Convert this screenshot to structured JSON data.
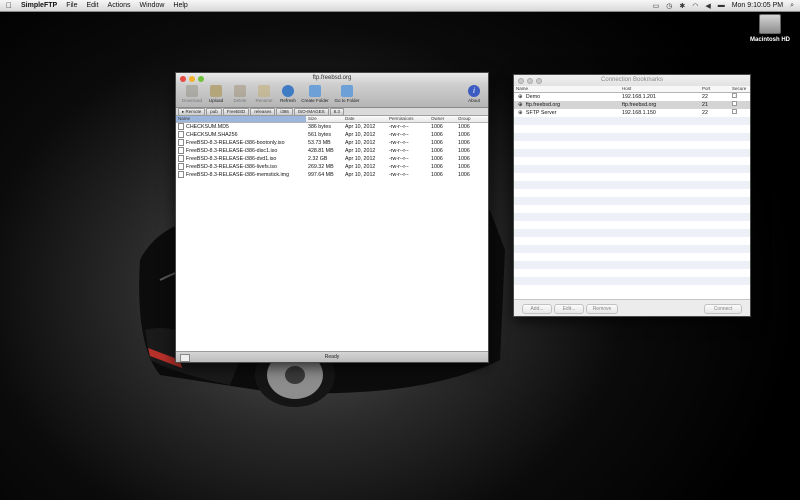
{
  "menubar": {
    "app_name": "SimpleFTP",
    "items": [
      "File",
      "Edit",
      "Actions",
      "Window",
      "Help"
    ],
    "clock": "Mon 9:10:05 PM"
  },
  "desktop": {
    "disk_label": "Macintosh HD"
  },
  "ftp_window": {
    "title": "ftp.freebsd.org",
    "toolbar": {
      "download": "Download",
      "upload": "Upload",
      "delete": "Delete",
      "rename": "Rename",
      "refresh": "Refresh",
      "create_folder": "Create Folder",
      "go_to_folder": "Go to Folder",
      "about": "About"
    },
    "path": [
      "Remote",
      "pub",
      "FreeBSD",
      "releases",
      "i386",
      "ISO-IMAGES",
      "8.3"
    ],
    "columns": [
      "Name",
      "Size",
      "Date",
      "Permissions",
      "Owner",
      "Group"
    ],
    "files": [
      {
        "name": "CHECKSUM.MD5",
        "size": "386 bytes",
        "date": "Apr 10, 2012",
        "perm": "-rw-r--r--",
        "owner": "1006",
        "group": "1006"
      },
      {
        "name": "CHECKSUM.SHA256",
        "size": "561 bytes",
        "date": "Apr 10, 2012",
        "perm": "-rw-r--r--",
        "owner": "1006",
        "group": "1006"
      },
      {
        "name": "FreeBSD-8.3-RELEASE-i386-bootonly.iso",
        "size": "53.73 MB",
        "date": "Apr 10, 2012",
        "perm": "-rw-r--r--",
        "owner": "1006",
        "group": "1006"
      },
      {
        "name": "FreeBSD-8.3-RELEASE-i386-disc1.iso",
        "size": "428.81 MB",
        "date": "Apr 10, 2012",
        "perm": "-rw-r--r--",
        "owner": "1006",
        "group": "1006"
      },
      {
        "name": "FreeBSD-8.3-RELEASE-i386-dvd1.iso",
        "size": "2.32 GB",
        "date": "Apr 10, 2012",
        "perm": "-rw-r--r--",
        "owner": "1006",
        "group": "1006"
      },
      {
        "name": "FreeBSD-8.3-RELEASE-i386-livefs.iso",
        "size": "269.32 MB",
        "date": "Apr 10, 2012",
        "perm": "-rw-r--r--",
        "owner": "1006",
        "group": "1006"
      },
      {
        "name": "FreeBSD-8.3-RELEASE-i386-memstick.img",
        "size": "997.64 MB",
        "date": "Apr 10, 2012",
        "perm": "-rw-r--r--",
        "owner": "1006",
        "group": "1006"
      }
    ],
    "status": "Ready"
  },
  "bookmarks_window": {
    "title": "Connection Bookmarks",
    "columns": [
      "Name",
      "Host",
      "Port",
      "Secure"
    ],
    "rows": [
      {
        "name": "Demo",
        "host": "192.168.1.201",
        "port": "22",
        "secure": "✓"
      },
      {
        "name": "ftp.freebsd.org",
        "host": "ftp.freebsd.org",
        "port": "21",
        "secure": ""
      },
      {
        "name": "SFTP Server",
        "host": "192.168.1.150",
        "port": "22",
        "secure": "✓"
      }
    ],
    "buttons": {
      "add": "Add...",
      "edit": "Edit...",
      "remove": "Remove",
      "connect": "Connect"
    }
  }
}
